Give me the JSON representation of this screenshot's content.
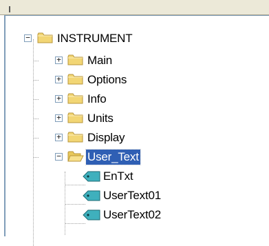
{
  "tree": {
    "root": {
      "label": "INSTRUMENT",
      "expanded": true,
      "icon": "folder-icon"
    },
    "children": [
      {
        "label": "Main",
        "expanded": false,
        "icon": "folder-icon"
      },
      {
        "label": "Options",
        "expanded": false,
        "icon": "folder-icon"
      },
      {
        "label": "Info",
        "expanded": false,
        "icon": "folder-icon"
      },
      {
        "label": "Units",
        "expanded": false,
        "icon": "folder-icon"
      },
      {
        "label": "Display",
        "expanded": false,
        "icon": "folder-icon"
      },
      {
        "label": "User_Text",
        "expanded": true,
        "selected": true,
        "icon": "open-folder-icon",
        "children": [
          {
            "label": "EnTxt",
            "icon": "tag-icon"
          },
          {
            "label": "UserText01",
            "icon": "tag-icon"
          },
          {
            "label": "UserText02",
            "icon": "tag-icon"
          }
        ]
      }
    ]
  },
  "colors": {
    "selection": "#2f5fb4",
    "folder": "#f2d675",
    "tag": "#3fb0bd"
  }
}
